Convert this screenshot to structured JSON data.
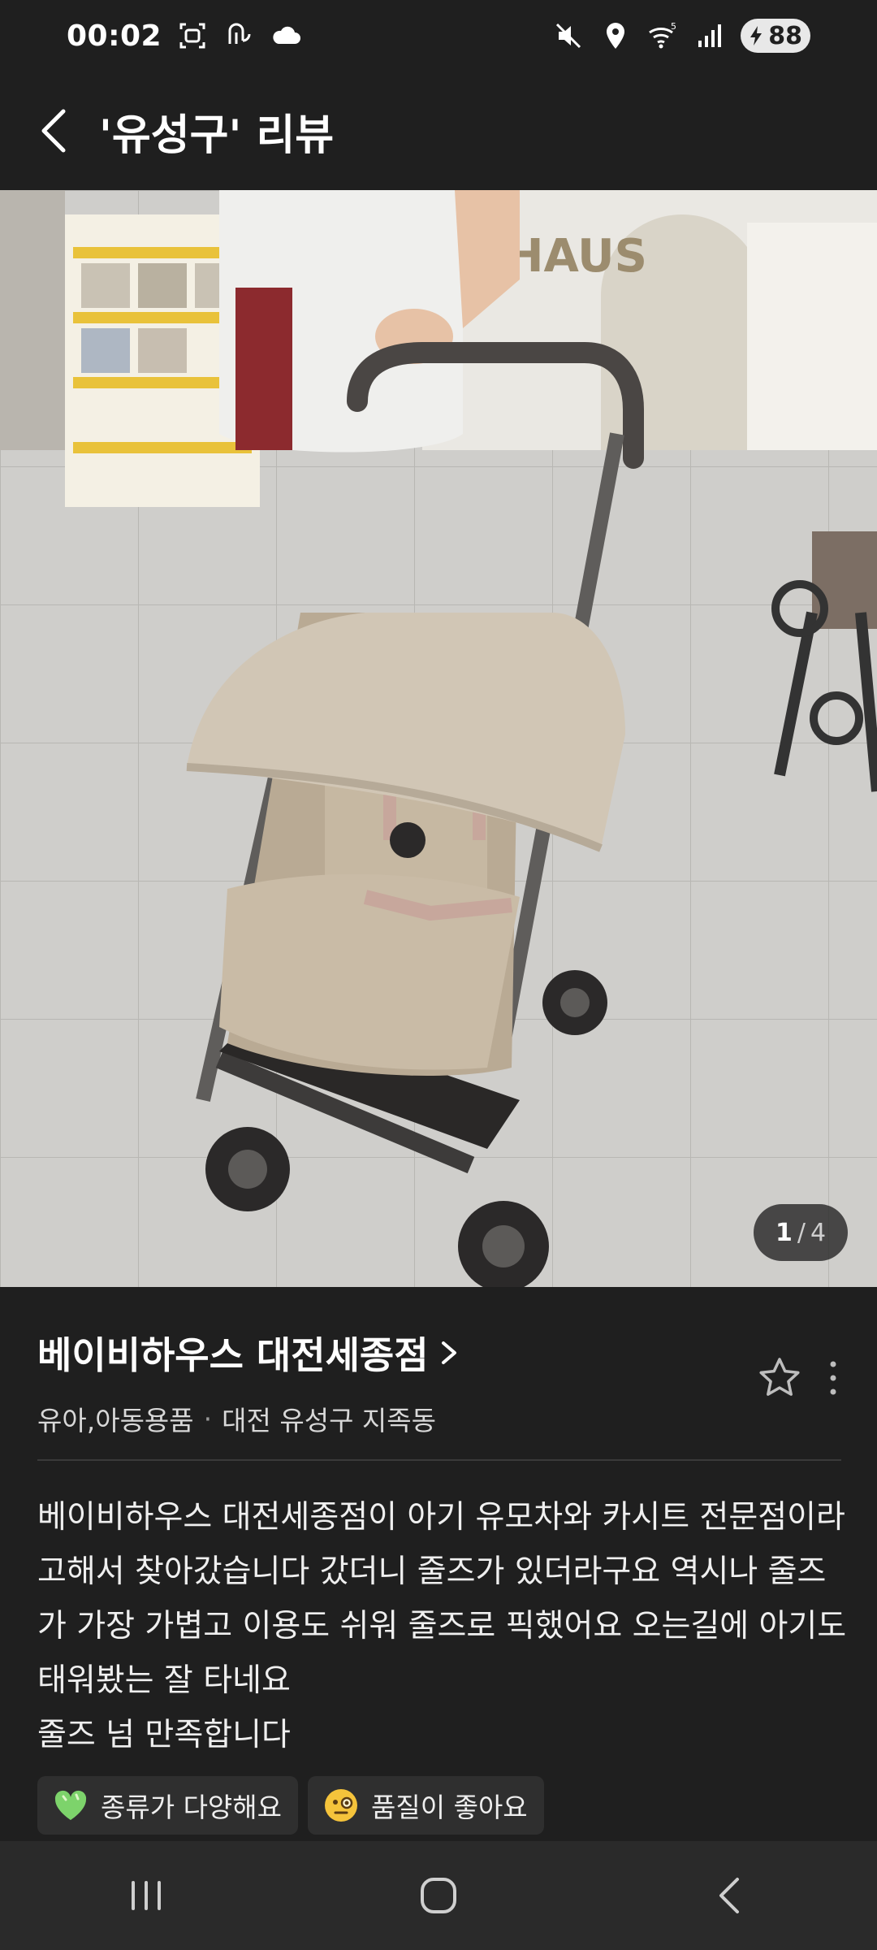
{
  "status_bar": {
    "time": "00:02",
    "battery": "88",
    "icons": [
      "screenshot-icon",
      "nfc-icon",
      "cloud-icon",
      "mute-icon",
      "location-icon",
      "wifi-5g-icon",
      "signal-icon",
      "battery-icon"
    ]
  },
  "header": {
    "title": "'유성구' 리뷰",
    "back_icon": "back-arrow-icon"
  },
  "gallery": {
    "current": "1",
    "separator": "/",
    "total": "4"
  },
  "place": {
    "name": "베이비하우스 대전세종점",
    "category": "유아,아동용품",
    "separator": "·",
    "location": "대전 유성구 지족동"
  },
  "review": {
    "text": "베이비하우스 대전세종점이 아기 유모차와 카시트 전문점이라 고해서 찾아갔습니다 갔더니 줄즈가 있더라구요 역시나 줄즈가 가장 가볍고 이용도 쉬워 줄즈로 픽했어요 오는길에 아기도 태워봤는 잘 타네요\n줄즈 넘 만족합니다"
  },
  "tags": [
    {
      "label": "종류가 다양해요",
      "icon": "green-heart-icon"
    },
    {
      "label": "품질이 좋아요",
      "icon": "monocle-face-icon"
    }
  ],
  "colors": {
    "background": "#1f1f1f",
    "tag_background": "#2f2f2f",
    "navbar": "#2a2a2a"
  }
}
